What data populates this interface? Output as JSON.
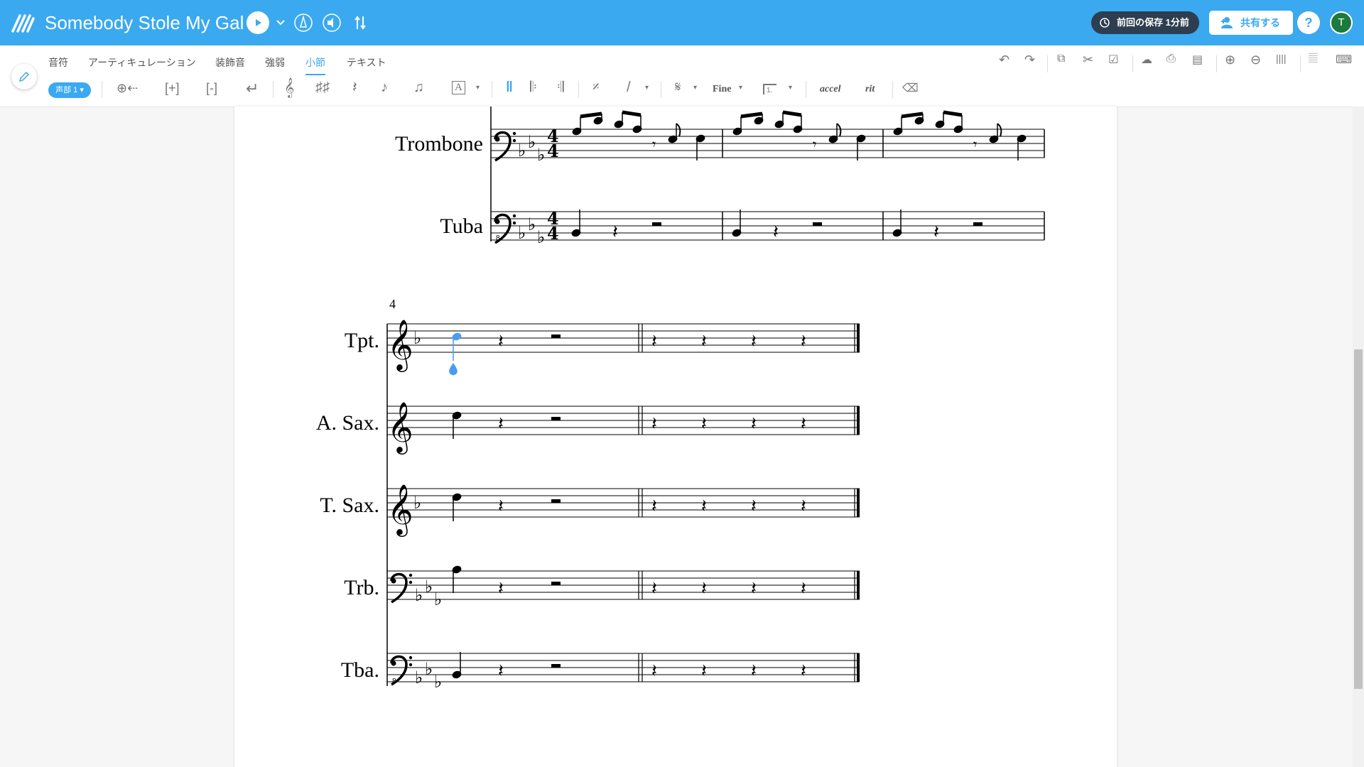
{
  "app": {
    "title": "Somebody Stole My Gal",
    "last_saved": "前回の保存 1分前",
    "share_label": "共有する",
    "help_label": "?",
    "avatar_initial": "T"
  },
  "toolbar": {
    "tabs": [
      "音符",
      "アーティキュレーション",
      "装飾音",
      "強弱",
      "小節",
      "テキスト"
    ],
    "active_tab": "小節",
    "voice_label": "声部 1",
    "text_tool": "A",
    "fine_label": "Fine",
    "volta_label": "1.",
    "accel_label": "accel",
    "rit_label": "rit"
  },
  "score": {
    "system1_instruments": [
      "Trombone",
      "Tuba"
    ],
    "system2_instruments": [
      "Tpt.",
      "A. Sax.",
      "T. Sax.",
      "Trb.",
      "Tba."
    ],
    "system2_measure_number": "4"
  },
  "colors": {
    "topbar": "#3aa9f0",
    "accent": "#3aa9f0",
    "selected_note": "#4b9bf0"
  }
}
